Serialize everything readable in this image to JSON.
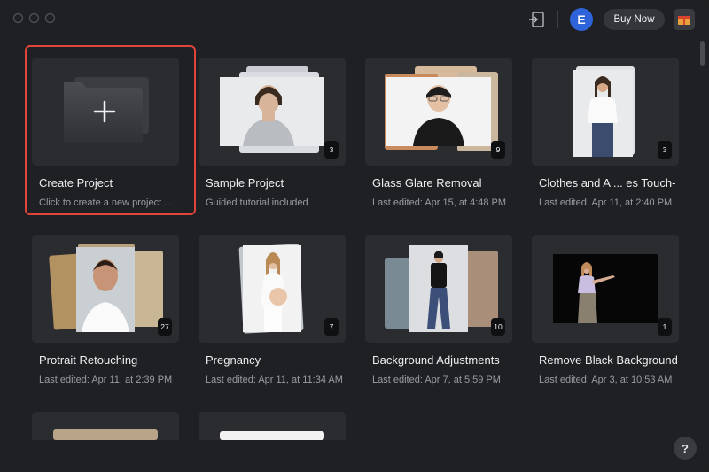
{
  "window": {
    "controls": [
      "close",
      "minimize",
      "zoom"
    ]
  },
  "header": {
    "import_icon": "import-icon",
    "avatar_initial": "E",
    "buy_label": "Buy Now",
    "gift_icon": "gift-icon"
  },
  "projects": [
    {
      "title": "Create Project",
      "subtitle": "Click to create a new project ...",
      "badge": ""
    },
    {
      "title": "Sample Project",
      "subtitle": "Guided tutorial included",
      "badge": "3"
    },
    {
      "title": "Glass Glare Removal",
      "subtitle": "Last edited: Apr 15, at 4:48 PM",
      "badge": "9"
    },
    {
      "title": "Clothes and A ... es Touch-",
      "subtitle": "Last edited: Apr 11, at 2:40 PM",
      "badge": "3"
    },
    {
      "title": "Protrait Retouching",
      "subtitle": "Last edited: Apr 11, at 2:39 PM",
      "badge": "27"
    },
    {
      "title": "Pregnancy",
      "subtitle": "Last edited: Apr 11, at 11:34 AM",
      "badge": "7"
    },
    {
      "title": "Background Adjustments",
      "subtitle": "Last edited: Apr 7, at 5:59 PM",
      "badge": "10"
    },
    {
      "title": "Remove Black Background",
      "subtitle": "Last edited: Apr 3, at 10:53 AM",
      "badge": "1"
    }
  ],
  "help_label": "?",
  "colors": {
    "accent_selection": "#e0443a",
    "avatar_bg": "#2f63d9",
    "background": "#1f2023"
  }
}
